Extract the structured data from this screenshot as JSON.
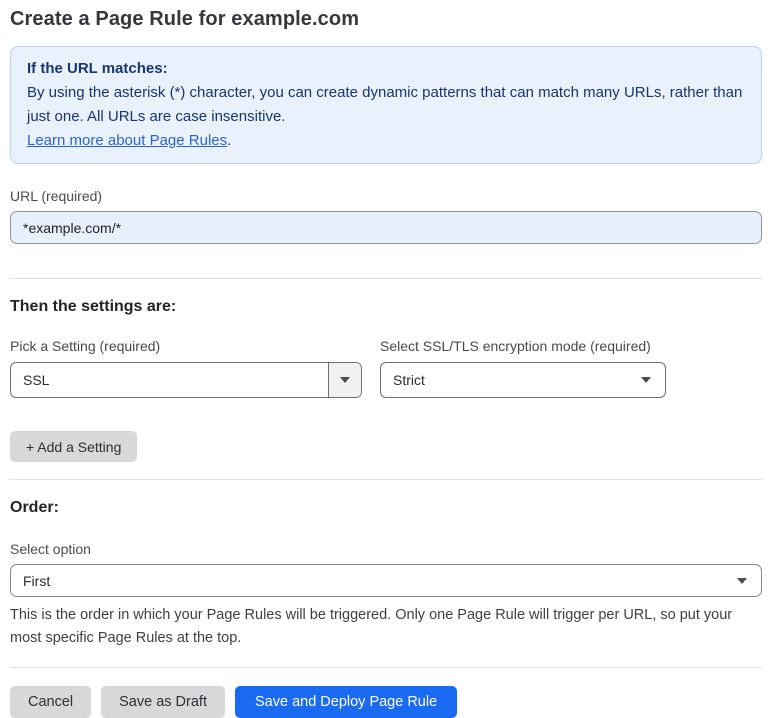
{
  "page": {
    "title": "Create a Page Rule for example.com"
  },
  "info_box": {
    "heading": "If the URL matches:",
    "body": "By using the asterisk (*) character, you can create dynamic patterns that can match many URLs, rather than just one. All URLs are case insensitive.",
    "link": "Learn more about Page Rules",
    "link_suffix": "."
  },
  "url_field": {
    "label": "URL (required)",
    "value": "*example.com/*"
  },
  "settings": {
    "heading": "Then the settings are:",
    "pick_setting_label": "Pick a Setting (required)",
    "pick_setting_value": "SSL",
    "encryption_mode_label": "Select SSL/TLS encryption mode (required)",
    "encryption_mode_value": "Strict",
    "add_button_label": "+ Add a Setting"
  },
  "order": {
    "heading": "Order:",
    "select_label": "Select option",
    "select_value": "First",
    "help_text": "This is the order in which your Page Rules will be triggered. Only one Page Rule will trigger per URL, so put your most specific Page Rules at the top."
  },
  "actions": {
    "cancel_label": "Cancel",
    "save_draft_label": "Save as Draft",
    "save_deploy_label": "Save and Deploy Page Rule"
  },
  "colors": {
    "accent_blue": "#1a6bf2",
    "info_box_bg": "#e9f2fc",
    "info_box_border": "#b9d2ee",
    "info_box_text": "#17366b",
    "link_blue": "#2d64c8",
    "url_input_bg": "#e8f0fd",
    "gray_button_bg": "#d8d8da"
  }
}
